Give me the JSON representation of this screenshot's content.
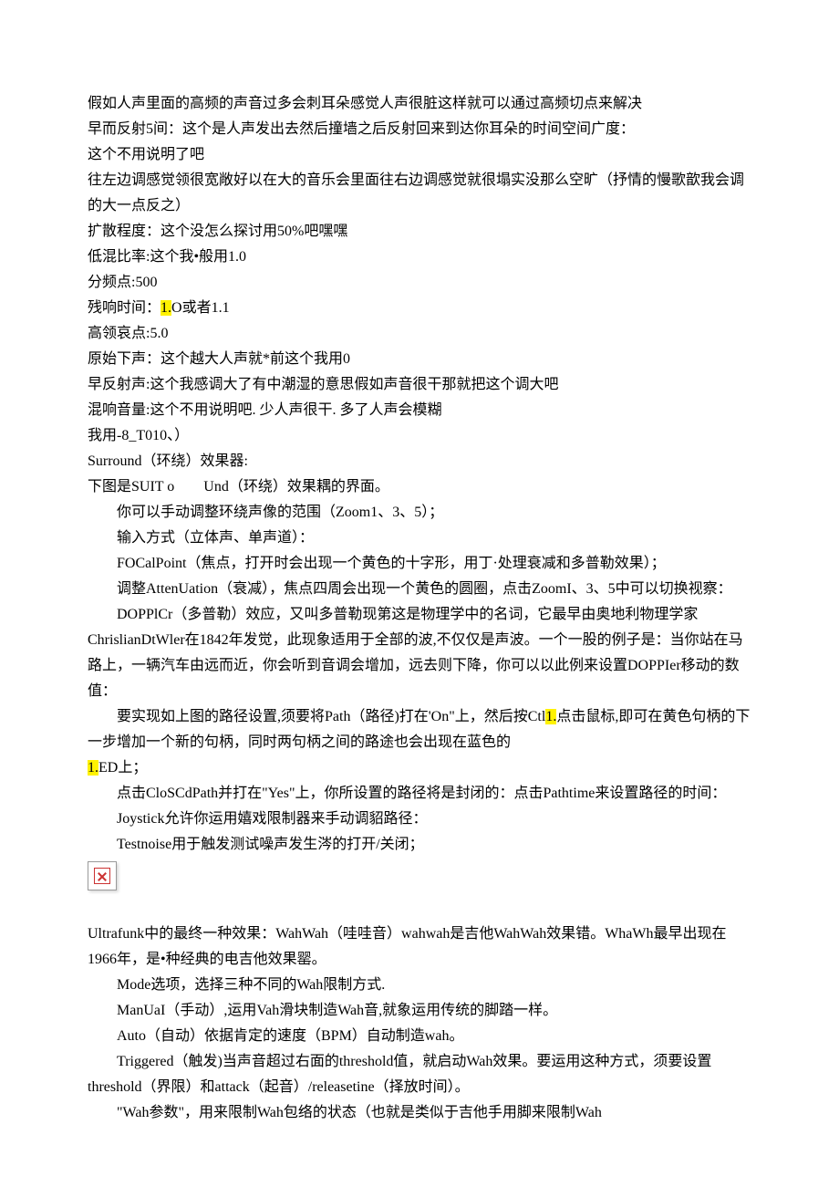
{
  "lines": {
    "l01": "假如人声里面的高频的声音过多会刺耳朵感觉人声很脏这样就可以通过高频切点来解决",
    "l02": "早而反射5间：这个是人声发出去然后撞墙之后反射回来到达你耳朵的时间空间广度：",
    "l03": "这个不用说明了吧",
    "l04": "往左边调感觉领很宽敞好以在大的音乐会里面往右边调感觉就很塌实没那么空旷（抒情的慢歌歆我会调的大一点反之）",
    "l05": "扩散程度：这个没怎么探讨用50%吧嘿嘿",
    "l06": "低混比率:这个我•般用1.0",
    "l07": "分频点:500",
    "l08a": "残响时间：",
    "l08h": "1.",
    "l08b": "O或者1.1",
    "l09": "高领哀点:5.0",
    "l10": "原始下声：这个越大人声就*前这个我用0",
    "l11": "早反射声:这个我感调大了有中潮湿的意思假如声音很干那就把这个调大吧",
    "l12": "混响音量:这个不用说明吧. 少人声很干. 多了人声会模糊",
    "l13": "我用-8_T010、）",
    "l14": "Surround（环绕）效果器:",
    "l15": "下图是SUIT o　　Und（环绕）效果耦的界面。",
    "l16": "你可以手动调整环绕声像的范围（Zoom1、3、5）；",
    "l17": "输入方式（立体声、单声道）：",
    "l18": "FOCalPoint（焦点，打开时会出现一个黄色的十字形，用丁·处理衰减和多普勒效果）；",
    "l19": "调整AttenUation（衰减），焦点四周会出现一个黄色的圆圈，点击ZoomI、3、5中可以切换视察：",
    "l20": "DOPPlCr（多普勒）效应，又叫多普勒现第这是物理学中的名词，它最早由奥地利物理学家ChrislianDtWler在1842年发觉，此现象适用于全部的波,不仅仅是声波。一个一股的例子是：当你站在马路上，一辆汽车由远而近，你会听到音调会增加，远去则下降，你可以以此例来设置DOPPIer移动的数值：",
    "l21a": "要实现如上图的路径设置,须要将Path（路径)打在'On\"上，然后按Ctl",
    "l21h": "1.",
    "l21b": "点击鼠标,即可在黄色句柄的下一步增加一个新的句柄，同时两句柄之间的路途也会出现在蓝色的",
    "l21h2": "1.",
    "l21c": "ED上；",
    "l22": "点击CloSCdPath并打在\"Yes\"上，你所设置的路径将是封闭的：点击Pathtime来设置路径的时间：",
    "l23": "Joystick允许你运用嬉戏限制器来手动调貂路径：",
    "l24": "Testnoise用于触发测试噪声发生涔的打开/关闭；",
    "l25": "Ultrafunk中的最终一种效果：WahWah（哇哇音）wahwah是吉他WahWah效果错。WhaWh最早出现在1966年，是•种经典的电吉他效果罂。",
    "l26": "Mode选项，选择三种不同的Wah限制方式.",
    "l27": "ManUaI（手动）,运用Vah滑块制造Wah音,就象运用传统的脚踏一样。",
    "l28": "Auto（自动）依据肯定的速度（BPM）自动制造wah。",
    "l29": "Triggered（触发)当声音超过右面的threshold值，就启动Wah效果。要运用这种方式，须要设置threshold（界限）和attack（起音）/releasetine（择放时间）。",
    "l30": "\"Wah参数\"，用来限制Wah包络的状态（也就是类似于吉他手用脚来限制Wah"
  }
}
